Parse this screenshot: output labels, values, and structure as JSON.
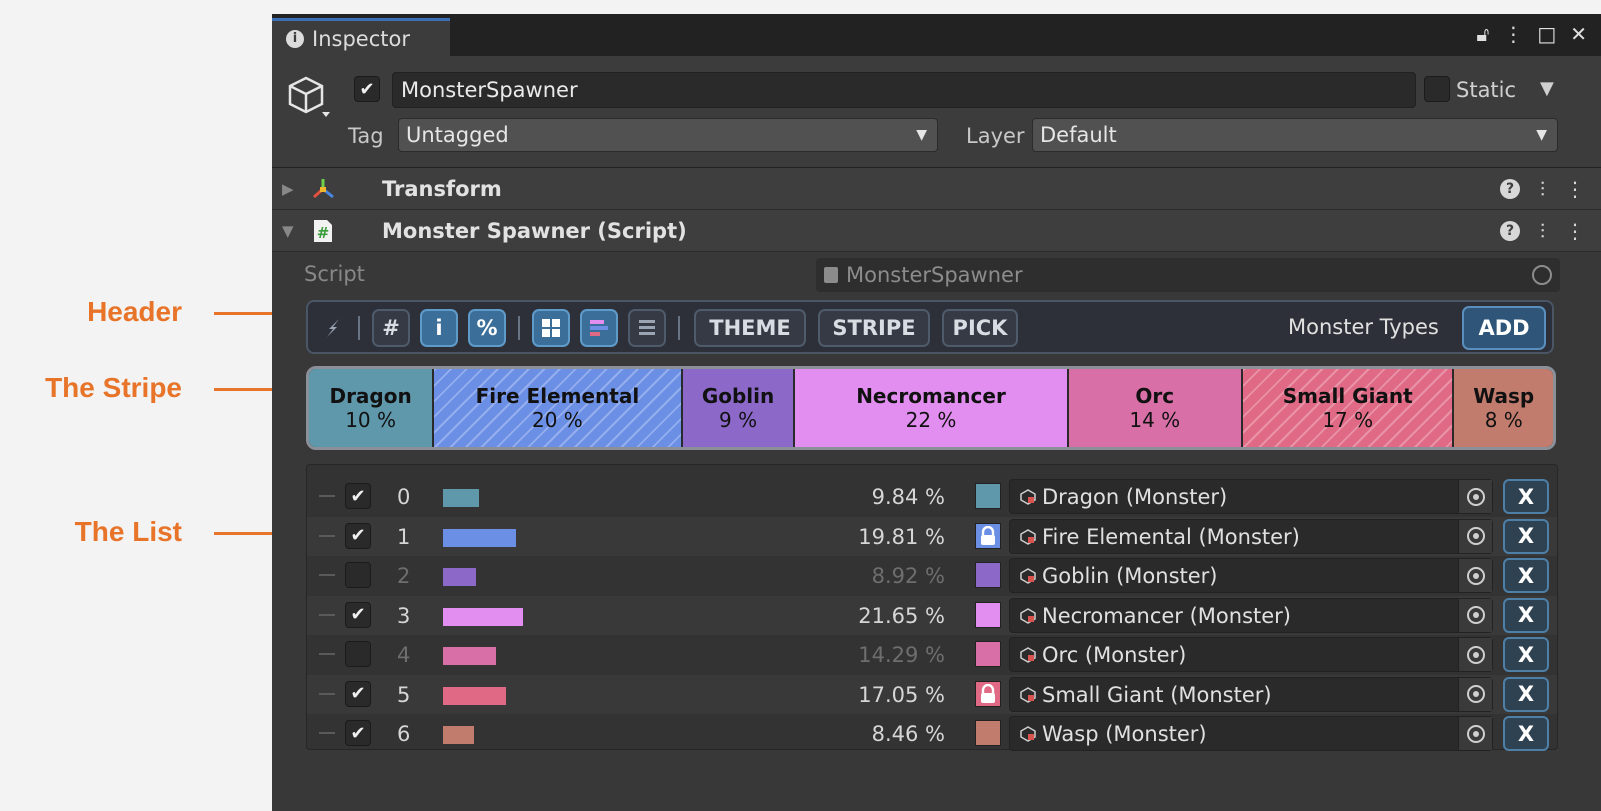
{
  "annotations": [
    {
      "label": "Header",
      "key": "header"
    },
    {
      "label": "The Stripe",
      "key": "stripe"
    },
    {
      "label": "The List",
      "key": "list"
    }
  ],
  "window": {
    "tab_label": "Inspector",
    "tab_icon": "info-icon",
    "controls": [
      "lock-icon",
      "more-icon",
      "maximize-icon",
      "close-icon"
    ]
  },
  "gameobject": {
    "enabled": true,
    "name": "MonsterSpawner",
    "static_label": "Static",
    "static_checked": false,
    "tag_label": "Tag",
    "tag_value": "Untagged",
    "layer_label": "Layer",
    "layer_value": "Default"
  },
  "components": [
    {
      "title": "Transform",
      "expanded": false,
      "icon": "transform-icon"
    },
    {
      "title": "Monster Spawner (Script)",
      "expanded": true,
      "icon": "script-icon"
    }
  ],
  "script_field": {
    "label": "Script",
    "value": "MonsterSpawner"
  },
  "toolbar": {
    "icon_buttons": [
      "wrench-icon",
      "#",
      "i",
      "%",
      "grid-icon",
      "bars-color-icon",
      "bars-icon"
    ],
    "theme_label": "THEME",
    "stripe_label": "STRIPE",
    "pick_label": "PICK",
    "title": "Monster Types",
    "add_label": "ADD"
  },
  "stripe": [
    {
      "name": "Dragon",
      "percent": "10 %",
      "value": 10,
      "color": "#5f97ab",
      "hatched": false
    },
    {
      "name": "Fire Elemental",
      "percent": "20 %",
      "value": 20,
      "color": "#6c8fe6",
      "hatched": true
    },
    {
      "name": "Goblin",
      "percent": "9 %",
      "value": 9,
      "color": "#8c68c9",
      "hatched": false
    },
    {
      "name": "Necromancer",
      "percent": "22 %",
      "value": 22,
      "color": "#e28ef0",
      "hatched": false
    },
    {
      "name": "Orc",
      "percent": "14 %",
      "value": 14,
      "color": "#d86fa6",
      "hatched": false
    },
    {
      "name": "Small Giant",
      "percent": "17 %",
      "value": 17,
      "color": "#e06a86",
      "hatched": true
    },
    {
      "name": "Wasp",
      "percent": "8 %",
      "value": 8,
      "color": "#c27c6e",
      "hatched": false
    }
  ],
  "list": [
    {
      "index": "0",
      "enabled": true,
      "percent": "9.84 %",
      "value": 9.84,
      "color": "#5f97ab",
      "locked": false,
      "object": "Dragon (Monster)",
      "remove": "X"
    },
    {
      "index": "1",
      "enabled": true,
      "percent": "19.81 %",
      "value": 19.81,
      "color": "#6c8fe6",
      "locked": true,
      "object": "Fire Elemental (Monster)",
      "remove": "X"
    },
    {
      "index": "2",
      "enabled": false,
      "percent": "8.92 %",
      "value": 8.92,
      "color": "#8c68c9",
      "locked": false,
      "object": "Goblin (Monster)",
      "remove": "X"
    },
    {
      "index": "3",
      "enabled": true,
      "percent": "21.65 %",
      "value": 21.65,
      "color": "#e28ef0",
      "locked": false,
      "object": "Necromancer (Monster)",
      "remove": "X"
    },
    {
      "index": "4",
      "enabled": false,
      "percent": "14.29 %",
      "value": 14.29,
      "color": "#d86fa6",
      "locked": false,
      "object": "Orc (Monster)",
      "remove": "X"
    },
    {
      "index": "5",
      "enabled": true,
      "percent": "17.05 %",
      "value": 17.05,
      "color": "#e06a86",
      "locked": true,
      "object": "Small Giant (Monster)",
      "remove": "X"
    },
    {
      "index": "6",
      "enabled": true,
      "percent": "8.46 %",
      "value": 8.46,
      "color": "#c27c6e",
      "locked": false,
      "object": "Wasp (Monster)",
      "remove": "X"
    }
  ]
}
